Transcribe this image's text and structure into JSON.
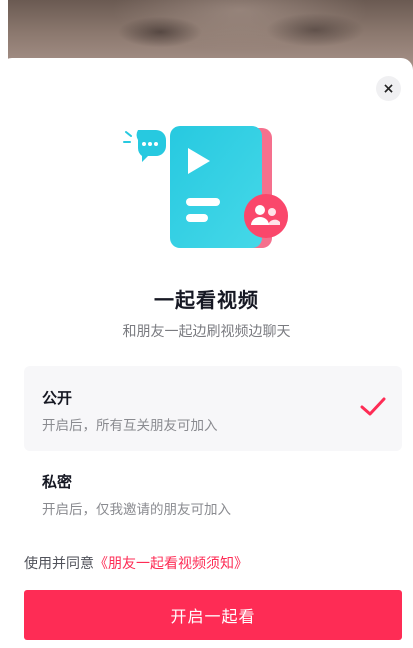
{
  "background": {
    "description_icon": "video-frame"
  },
  "close": {
    "label": "×",
    "icon": "close-icon"
  },
  "header": {
    "title": "一起看视频",
    "subtitle": "和朋友一起边刷视频边聊天"
  },
  "options": [
    {
      "title": "公开",
      "description": "开启后，所有互关朋友可加入",
      "selected": true
    },
    {
      "title": "私密",
      "description": "开启后，仅我邀请的朋友可加入",
      "selected": false
    }
  ],
  "agreement": {
    "prefix": "使用并同意",
    "link_text": "《朋友一起看视频须知》"
  },
  "cta": {
    "label": "开启一起看"
  },
  "colors": {
    "accent": "#fe2c55",
    "card_cyan": "#27c9e0",
    "card_pink": "#f5708d",
    "text_primary": "#161823",
    "text_secondary": "#8a8b90"
  }
}
